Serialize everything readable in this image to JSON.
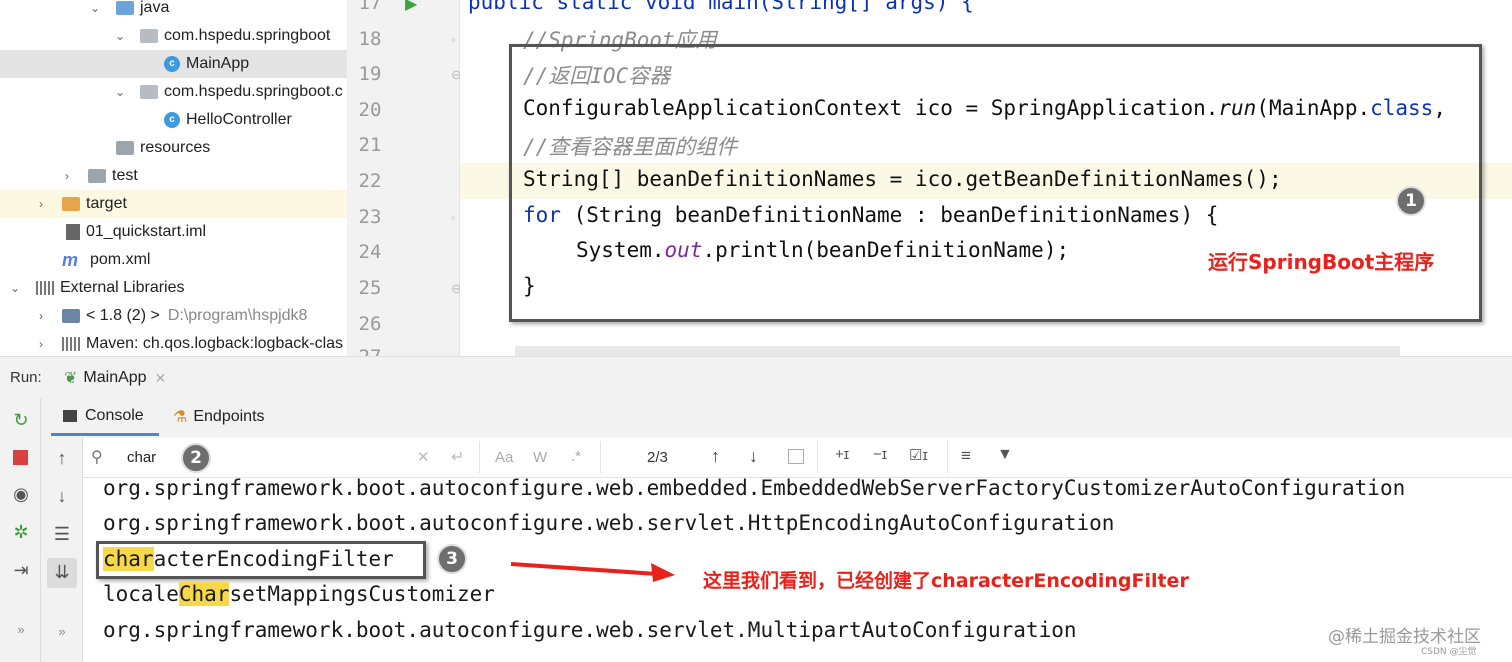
{
  "project_tree": {
    "items": [
      {
        "label": "java",
        "icon": "source-folder-icon"
      },
      {
        "label": "com.hspedu.springboot",
        "icon": "package-icon"
      },
      {
        "label": "MainApp",
        "icon": "class-icon"
      },
      {
        "label": "com.hspedu.springboot.c",
        "icon": "package-icon"
      },
      {
        "label": "HelloController",
        "icon": "class-icon"
      },
      {
        "label": "resources",
        "icon": "resources-folder-icon"
      },
      {
        "label": "test",
        "icon": "folder-icon"
      },
      {
        "label": "target",
        "icon": "excluded-folder-icon"
      },
      {
        "label": "01_quickstart.iml",
        "icon": "module-file-icon"
      },
      {
        "label": "pom.xml",
        "icon": "maven-icon"
      },
      {
        "label": "External Libraries",
        "icon": "library-icon"
      },
      {
        "label": "< 1.8 (2) >",
        "suffix": "D:\\program\\hspjdk8",
        "icon": "jdk-icon"
      },
      {
        "label": "Maven: ch.qos.logback:logback-clas",
        "icon": "library-jar-icon"
      }
    ]
  },
  "editor": {
    "line_numbers": [
      "17",
      "18",
      "19",
      "20",
      "21",
      "22",
      "23",
      "24",
      "25",
      "26",
      "27"
    ],
    "line17": "public static void main(String[] args) {",
    "comment1": "//SpringBoot应用",
    "comment2": "//返回IOC容器",
    "line20a": "ConfigurableApplicationContext ico = SpringApplication.",
    "line20b": "run",
    "line20c": "(MainApp.",
    "line20d": "class",
    "line20e": ",",
    "comment3": "//查看容器里面的组件",
    "line22": "String[] beanDefinitionNames = ico.getBeanDefinitionNames();",
    "line23a": "for",
    "line23b": " (String beanDefinitionName : beanDefinitionNames) {",
    "line24a": "System.",
    "line24b": "out",
    "line24c": ".println(beanDefinitionName);",
    "line25": "}"
  },
  "annotations": {
    "badge1": "1",
    "badge2": "2",
    "badge3": "3",
    "note1": "运行SpringBoot主程序",
    "note3": "这里我们看到，已经创建了characterEncodingFilter"
  },
  "run_panel": {
    "run_label": "Run:",
    "run_tab": "MainApp",
    "tab_console": "Console",
    "tab_endpoints": "Endpoints",
    "search_query": "char",
    "match_count": "2/3",
    "option_case": "Aa",
    "option_word": "W",
    "option_regex": ".*"
  },
  "console_output": {
    "line1": "org.springframework.boot.autoconfigure.web.embedded.EmbeddedWebServerFactoryCustomizerAutoConfiguration",
    "line2": "org.springframework.boot.autoconfigure.web.servlet.HttpEncodingAutoConfiguration",
    "line3_match": "char",
    "line3_rest": "acterEncodingFilter",
    "line4_pre": "locale",
    "line4_match": "Char",
    "line4_rest": "setMappingsCustomizer",
    "line5": "org.springframework.boot.autoconfigure.web.servlet.MultipartAutoConfiguration"
  },
  "watermark": {
    "main": "@稀土掘金技术社区",
    "sub": "CSDN @尘觉"
  },
  "colors": {
    "keyword": "#0d33b0",
    "comment": "#8c8c8c",
    "annotation_red": "#e8221b",
    "match_highlight": "#f7d84a"
  }
}
